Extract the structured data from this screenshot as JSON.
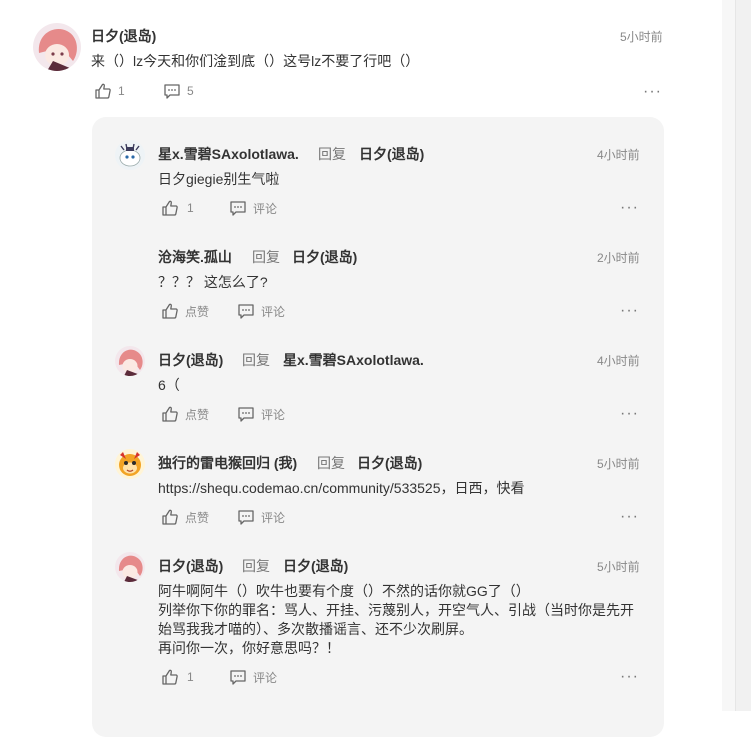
{
  "main_comment": {
    "author": "日夕(退岛)",
    "time": "5小时前",
    "text": "来（）lz今天和你们淦到底（）这号lz不要了行吧（）",
    "likes": "1",
    "comments": "5"
  },
  "replies": [
    {
      "author": "星x.雪碧SAxolotlawa.",
      "reply_word": "回复",
      "reply_to": "日夕(退岛)",
      "time": "4小时前",
      "lines": [
        "日夕giegie别生气啦"
      ],
      "like_label": "1",
      "comment_label": "评论"
    },
    {
      "author": "沧海笑.孤山",
      "reply_word": "回复",
      "reply_to": "日夕(退岛)",
      "time": "2小时前",
      "lines": [
        "？？？ 这怎么了?"
      ],
      "like_label": "点赞",
      "comment_label": "评论"
    },
    {
      "author": "日夕(退岛)",
      "reply_word": "回复",
      "reply_to": "星x.雪碧SAxolotlawa.",
      "time": "4小时前",
      "lines": [
        "6（"
      ],
      "like_label": "点赞",
      "comment_label": "评论"
    },
    {
      "author": "独行的雷电猴回归 (我)",
      "reply_word": "回复",
      "reply_to": "日夕(退岛)",
      "time": "5小时前",
      "lines": [
        "https://shequ.codemao.cn/community/533525，日西，快看"
      ],
      "like_label": "点赞",
      "comment_label": "评论"
    },
    {
      "author": "日夕(退岛)",
      "reply_word": "回复",
      "reply_to": "日夕(退岛)",
      "time": "5小时前",
      "lines": [
        "阿牛啊阿牛（）吹牛也要有个度（）不然的话你就GG了（）",
        "列举你下你的罪名：骂人、开挂、污蔑别人，开空气人、引战（当时你是先开",
        "始骂我我才喵的）、多次散播谣言、还不少次刷屏。",
        "再问你一次，你好意思吗？！"
      ],
      "like_label": "1",
      "comment_label": "评论"
    }
  ],
  "more_label": "···",
  "colors": {
    "background": "#ffffff",
    "reply_box": "#f4f4f4",
    "muted_text": "#888888",
    "name_text": "#333333"
  },
  "icons": [
    "thumbs-up-icon",
    "comment-icon",
    "more-icon"
  ]
}
